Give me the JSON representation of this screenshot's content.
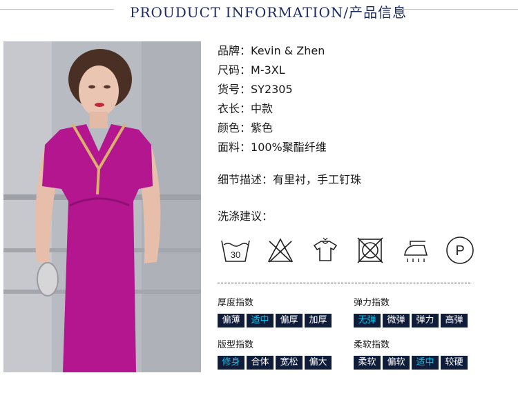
{
  "header": {
    "title": "PROUDUCT INFORMATION/产品信息"
  },
  "info": [
    {
      "key": "品牌：",
      "value": "Kevin & Zhen"
    },
    {
      "key": "尺码：",
      "value": "M-3XL"
    },
    {
      "key": "货号：",
      "value": "SY2305"
    },
    {
      "key": "衣长：",
      "value": "中款"
    },
    {
      "key": "颜色：",
      "value": "紫色"
    },
    {
      "key": "面料：",
      "value": "100%聚酯纤维"
    }
  ],
  "detail": {
    "key": "细节描述：",
    "value": "有里衬，手工钉珠"
  },
  "wash": {
    "title": "洗涤建议：",
    "icons": [
      "wash-30-icon",
      "no-bleach-icon",
      "hang-dry-icon",
      "no-tumble-dry-icon",
      "iron-icon",
      "professional-clean-p-icon"
    ],
    "wash_temp": "30",
    "p_letter": "P"
  },
  "indices": [
    {
      "title": "厚度指数",
      "options": [
        "偏薄",
        "适中",
        "偏厚",
        "加厚"
      ],
      "selected": 1
    },
    {
      "title": "弹力指数",
      "options": [
        "无弹",
        "微弹",
        "弹力",
        "高弹"
      ],
      "selected": 0
    },
    {
      "title": "版型指数",
      "options": [
        "修身",
        "合体",
        "宽松",
        "偏大"
      ],
      "selected": 0
    },
    {
      "title": "柔软指数",
      "options": [
        "柔软",
        "偏软",
        "适中",
        "较硬"
      ],
      "selected": 2
    }
  ],
  "colors": {
    "header_text": "#1c2c63",
    "cell_bg": "#0f1c3a",
    "active_text": "#00c8f0",
    "dress": "#b3168f"
  }
}
